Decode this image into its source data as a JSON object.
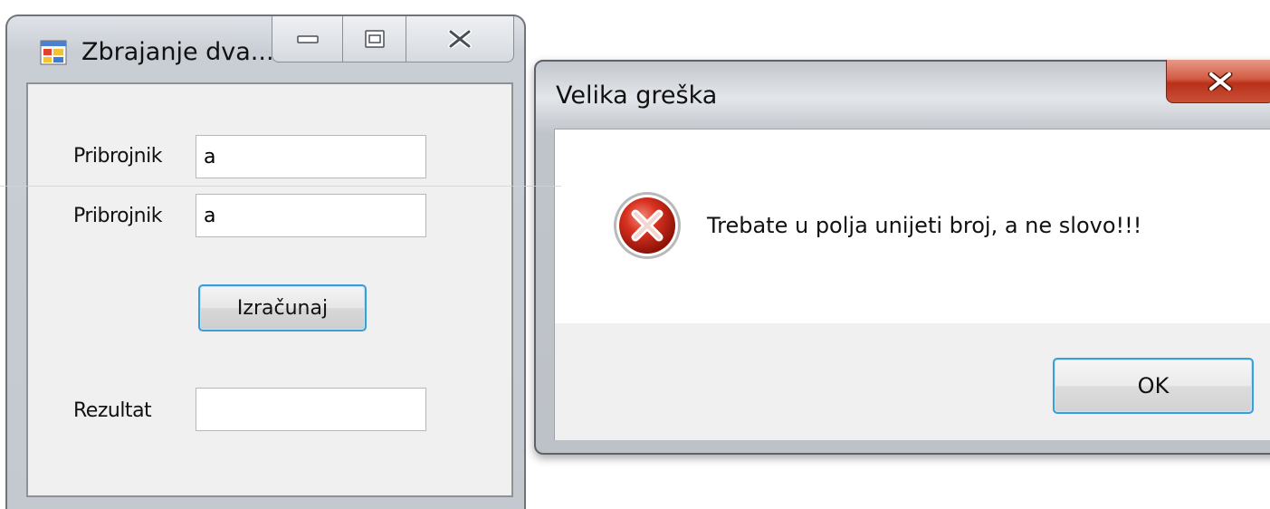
{
  "main_window": {
    "title": "Zbrajanje dva...",
    "icon": "app-form-icon",
    "caption_buttons": {
      "minimize": "minimize-icon",
      "maximize": "maximize-icon",
      "close": "close-icon"
    },
    "form": {
      "addend1_label": "Pribrojnik",
      "addend1_value": "a",
      "addend2_label": "Pribrojnik",
      "addend2_value": "a",
      "calc_button": "Izračunaj",
      "result_label": "Rezultat",
      "result_value": ""
    }
  },
  "error_dialog": {
    "title": "Velika greška",
    "icon": "error-icon",
    "message": "Trebate u polja unijeti broj, a ne slovo!!!",
    "ok_button": "OK",
    "close_icon": "close-icon"
  },
  "colors": {
    "focus_border": "#3c9ed8",
    "close_button_red": "#c9402a",
    "error_icon_red": "#d32a1e"
  }
}
